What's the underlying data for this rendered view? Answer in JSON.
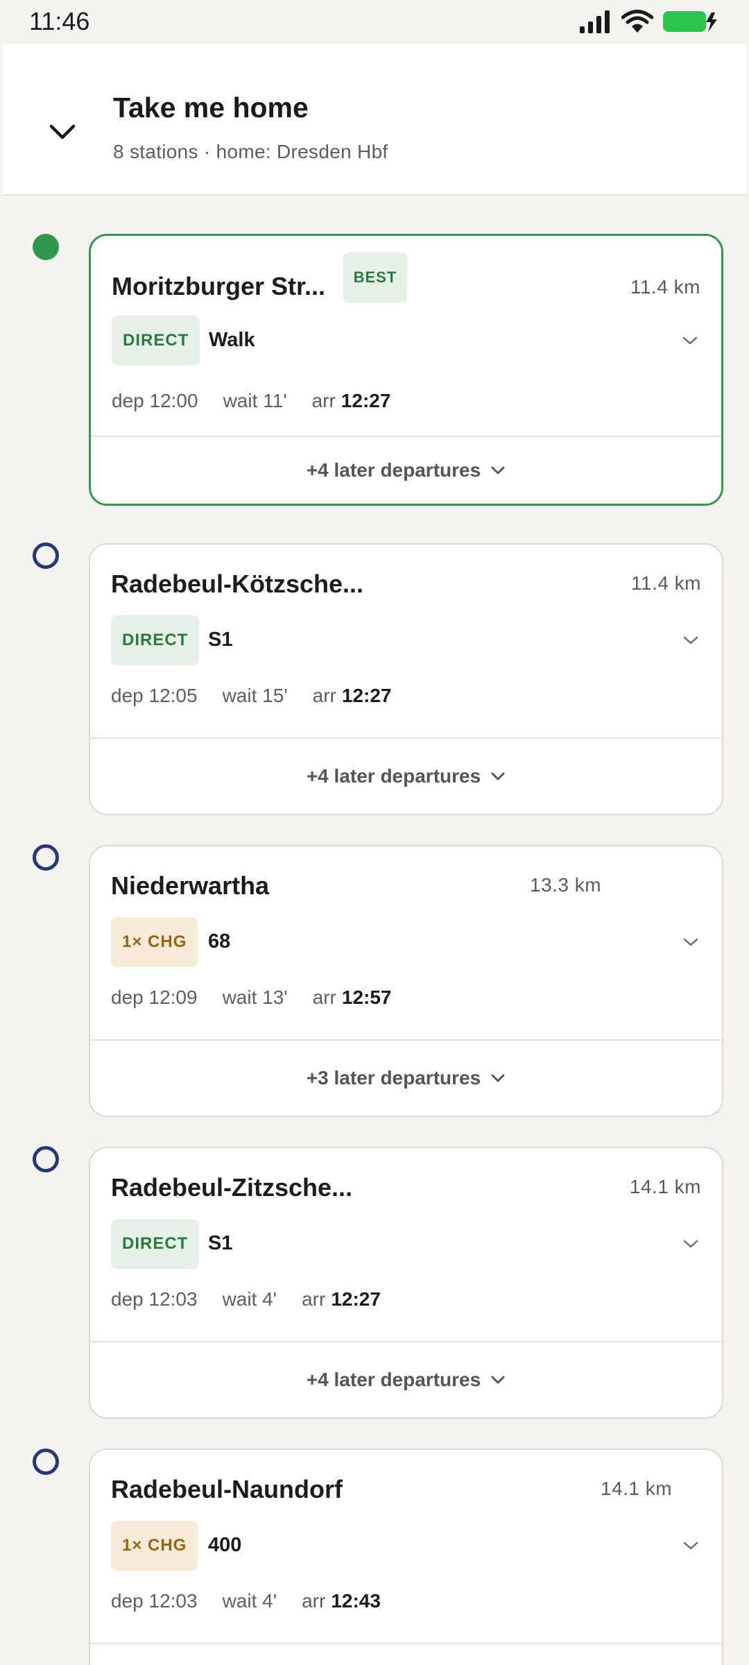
{
  "status_bar": {
    "time": "11:46"
  },
  "header": {
    "title": "Take me home",
    "subtitle": "8 stations · home: Dresden Hbf"
  },
  "stations": [
    {
      "name": "Moritzburger Str...",
      "badge": "BEST",
      "distance": "11.4 km",
      "type": "DIRECT",
      "line": "Walk",
      "dep": "dep 12:00",
      "wait": "wait 11'",
      "arr_label": "arr",
      "arr_time": "12:27",
      "later": "+4 later departures"
    },
    {
      "name": "Radebeul-Kötzsche...",
      "distance": "11.4 km",
      "type": "DIRECT",
      "line": "S1",
      "dep": "dep 12:05",
      "wait": "wait 15'",
      "arr_label": "arr",
      "arr_time": "12:27",
      "later": "+4 later departures"
    },
    {
      "name": "Niederwartha",
      "distance": "13.3 km",
      "type": "1× CHG",
      "line": "68",
      "dep": "dep 12:09",
      "wait": "wait 13'",
      "arr_label": "arr",
      "arr_time": "12:57",
      "later": "+3 later departures"
    },
    {
      "name": "Radebeul-Zitzsche...",
      "distance": "14.1 km",
      "type": "DIRECT",
      "line": "S1",
      "dep": "dep 12:03",
      "wait": "wait 4'",
      "arr_label": "arr",
      "arr_time": "12:27",
      "later": "+4 later departures"
    },
    {
      "name": "Radebeul-Naundorf",
      "distance": "14.1 km",
      "type": "1× CHG",
      "line": "400",
      "dep": "dep 12:03",
      "wait": "wait 4'",
      "arr_label": "arr",
      "arr_time": "12:43"
    }
  ],
  "colors": {
    "best_green": "#2f9a4c",
    "dot_blue": "#25377a",
    "direct_bg": "#e6f1e8",
    "chg_bg": "#f8ead8",
    "background": "#f5f3ef"
  },
  "icons": {
    "collapse": "chevron-down-icon",
    "expand": "chevron-down-icon",
    "signal": "cellular-signal-icon",
    "wifi": "wifi-icon",
    "battery": "battery-charging-icon"
  }
}
